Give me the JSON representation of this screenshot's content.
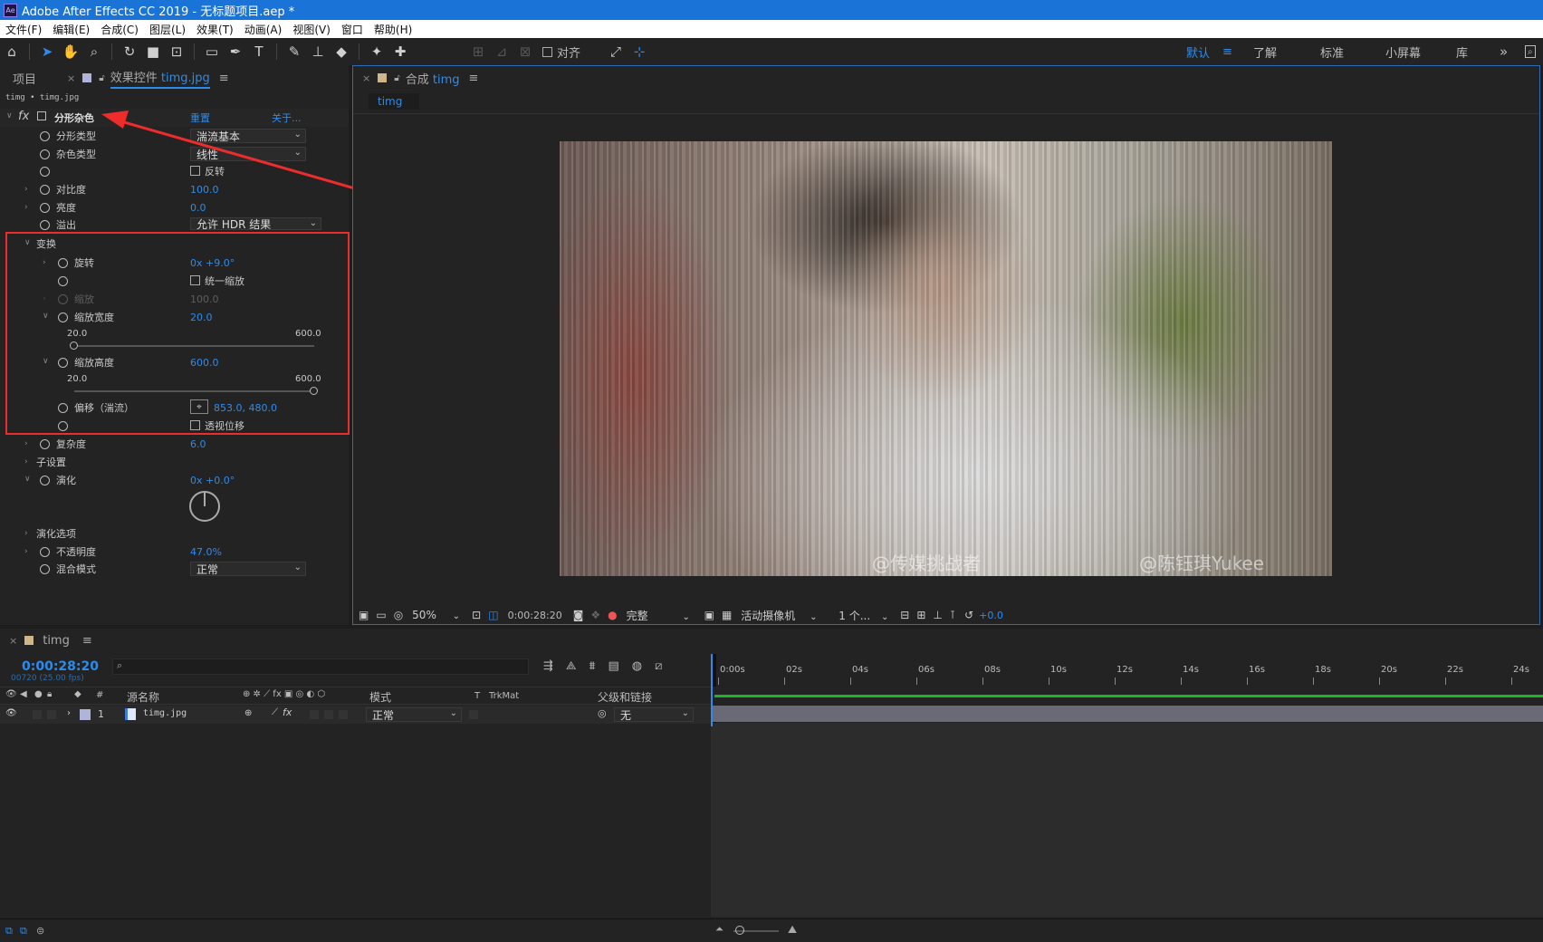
{
  "window": {
    "title": "Adobe After Effects CC 2019 - 无标题项目.aep *",
    "icon_text": "Ae"
  },
  "menu": [
    "文件(F)",
    "编辑(E)",
    "合成(C)",
    "图层(L)",
    "效果(T)",
    "动画(A)",
    "视图(V)",
    "窗口",
    "帮助(H)"
  ],
  "toolbar": {
    "align_label": "对齐"
  },
  "workspaces": {
    "default": "默认",
    "learn": "了解",
    "standard": "标准",
    "small_screen": "小屏幕",
    "library": "库"
  },
  "project_panel": {
    "tab_project": "项目",
    "tab_effects": "效果控件",
    "tab_effects_file": "timg.jpg",
    "breadcrumb": "timg • timg.jpg"
  },
  "effect": {
    "name": "分形杂色",
    "reset": "重置",
    "about": "关于...",
    "fractal_type_label": "分形类型",
    "fractal_type_value": "湍流基本",
    "noise_type_label": "杂色类型",
    "noise_type_value": "线性",
    "invert_label": "反转",
    "contrast_label": "对比度",
    "contrast_value": "100.0",
    "brightness_label": "亮度",
    "brightness_value": "0.0",
    "overflow_label": "溢出",
    "overflow_value": "允许 HDR 结果",
    "transform_label": "变换",
    "rotation_label": "旋转",
    "rotation_value": "0x +9.0°",
    "uniform_scale_label": "统一缩放",
    "scale_label": "缩放",
    "scale_value": "100.0",
    "scale_width_label": "缩放宽度",
    "scale_width_value": "20.0",
    "scale_width_min": "20.0",
    "scale_width_max": "600.0",
    "scale_height_label": "缩放高度",
    "scale_height_value": "600.0",
    "scale_height_min": "20.0",
    "scale_height_max": "600.0",
    "offset_label": "偏移（湍流）",
    "offset_value": "853.0, 480.0",
    "perspective_label": "透视位移",
    "complexity_label": "复杂度",
    "complexity_value": "6.0",
    "sub_settings_label": "子设置",
    "evolution_label": "演化",
    "evolution_value": "0x +0.0°",
    "evolution_options_label": "演化选项",
    "opacity_label": "不透明度",
    "opacity_value": "47.0%",
    "blend_mode_label": "混合模式",
    "blend_mode_value": "正常"
  },
  "composition": {
    "tab_prefix": "合成",
    "tab_name": "timg",
    "sub_tab": "timg",
    "watermark_1": "@传媒挑战者",
    "watermark_2": "@陈钰琪Yukee",
    "zoom": "50%",
    "timecode": "0:00:28:20",
    "quality": "完整",
    "camera": "活动摄像机",
    "views": "1 个...",
    "exposure": "+0.0"
  },
  "timeline": {
    "tab": "timg",
    "timecode": "0:00:28:20",
    "frames": "00720 (25.00 fps)",
    "col_num": "#",
    "col_source": "源名称",
    "col_mode": "模式",
    "col_t": "T",
    "col_trkmat": "TrkMat",
    "col_parent": "父级和链接",
    "layer_num": "1",
    "layer_name": "timg.jpg",
    "layer_mode": "正常",
    "layer_parent": "无",
    "ruler": [
      "0:00s",
      "02s",
      "04s",
      "06s",
      "08s",
      "10s",
      "12s",
      "14s",
      "16s",
      "18s",
      "20s",
      "22s",
      "24s"
    ]
  },
  "colors": {
    "accent": "#2d8ceb",
    "annotation": "#ee2c2c",
    "titlebar": "#1a73d6",
    "work_area": "#1bb52a"
  }
}
